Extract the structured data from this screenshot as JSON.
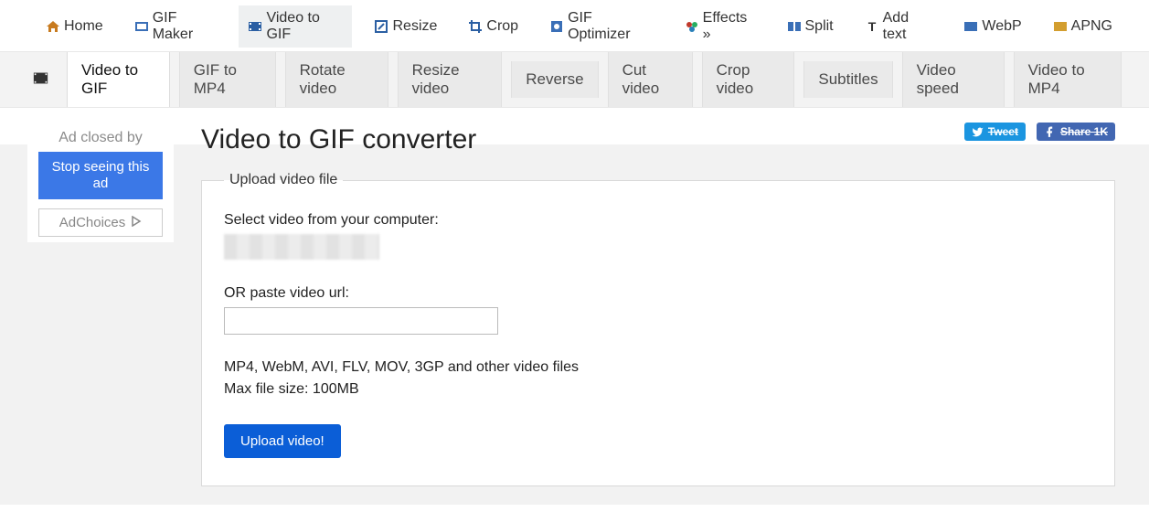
{
  "topnav": [
    {
      "label": "Home",
      "icon": "home"
    },
    {
      "label": "GIF Maker",
      "icon": "gif"
    },
    {
      "label": "Video to GIF",
      "icon": "video",
      "active": true
    },
    {
      "label": "Resize",
      "icon": "resize"
    },
    {
      "label": "Crop",
      "icon": "crop"
    },
    {
      "label": "GIF Optimizer",
      "icon": "optimize"
    },
    {
      "label": "Effects »",
      "icon": "effects"
    },
    {
      "label": "Split",
      "icon": "split"
    },
    {
      "label": "Add text",
      "icon": "text"
    },
    {
      "label": "WebP",
      "icon": "webp"
    },
    {
      "label": "APNG",
      "icon": "apng"
    }
  ],
  "subnav": [
    {
      "label": "Video to GIF",
      "active": true
    },
    {
      "label": "GIF to MP4"
    },
    {
      "label": "Rotate video"
    },
    {
      "label": "Resize video"
    },
    {
      "label": "Reverse"
    },
    {
      "label": "Cut video"
    },
    {
      "label": "Crop video"
    },
    {
      "label": "Subtitles"
    },
    {
      "label": "Video speed"
    },
    {
      "label": "Video to MP4"
    }
  ],
  "sidebar": {
    "ad_closed": "Ad closed by",
    "stop_seeing": "Stop seeing this ad",
    "adchoices": "AdChoices"
  },
  "share": {
    "tweet": "Tweet",
    "fbshare": "Share 1K"
  },
  "page": {
    "title": "Video to GIF converter",
    "legend": "Upload video file",
    "select_label": "Select video from your computer:",
    "or_paste_label": "OR paste video url:",
    "hint_line1": "MP4, WebM, AVI, FLV, MOV, 3GP and other video files",
    "hint_line2": "Max file size: 100MB",
    "upload_btn": "Upload video!"
  }
}
